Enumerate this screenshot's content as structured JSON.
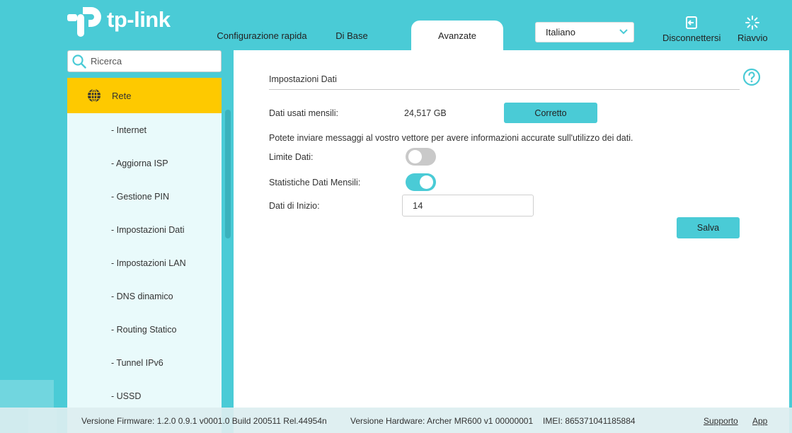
{
  "brand": {
    "name": "tp-link"
  },
  "header": {
    "tabs": [
      {
        "label": "Configurazione rapida",
        "active": false
      },
      {
        "label": "Di Base",
        "active": false
      },
      {
        "label": "Avanzate",
        "active": true
      }
    ],
    "language": {
      "selected": "Italiano"
    },
    "logout_label": "Disconnettersi",
    "reboot_label": "Riavvio"
  },
  "sidebar": {
    "search_placeholder": "Ricerca",
    "section": "Rete",
    "items": [
      "- Internet",
      "- Aggiorna ISP",
      "- Gestione PIN",
      "- Impostazioni Dati",
      "- Impostazioni LAN",
      "- DNS dinamico",
      "- Routing Statico",
      "- Tunnel IPv6",
      "- USSD"
    ]
  },
  "main": {
    "title": "Impostazioni Dati",
    "monthly_usage_label": "Dati usati mensili:",
    "monthly_usage_value": "24,517 GB",
    "correct_button": "Corretto",
    "info_text": "Potete inviare messaggi al vostro vettore per avere informazioni accurate sull'utilizzo dei dati.",
    "data_limit_label": "Limite Dati:",
    "data_limit_on": false,
    "monthly_stats_label": "Statistiche Dati Mensili:",
    "monthly_stats_on": true,
    "start_date_label": "Dati di Inizio:",
    "start_date_value": "14",
    "save_button": "Salva"
  },
  "footer": {
    "firmware": "Versione Firmware: 1.2.0 0.9.1 v0001.0 Build 200511 Rel.44954n",
    "hardware": "Versione Hardware: Archer MR600 v1 00000001",
    "imei": "IMEI: 865371041185884",
    "support": "Supporto",
    "app": "App"
  },
  "colors": {
    "accent": "#4acbd6",
    "highlight": "#fec900"
  }
}
